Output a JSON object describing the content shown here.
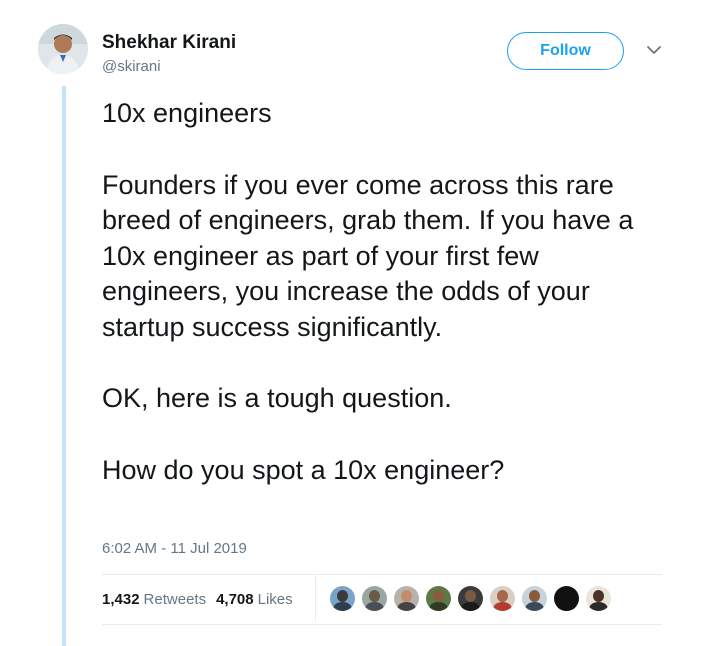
{
  "author": {
    "display_name": "Shekhar Kirani",
    "handle": "@skirani"
  },
  "follow_label": "Follow",
  "tweet": {
    "paragraphs": [
      "10x engineers",
      "Founders if you ever come across this rare breed of engineers, grab them. If you have a 10x engineer as part of your first few engineers, you increase the odds of your startup success significantly.",
      "OK, here is a tough question.",
      "How do you spot a 10x engineer?"
    ],
    "timestamp": "6:02 AM - 11 Jul 2019"
  },
  "stats": {
    "retweets_count": "1,432",
    "retweets_label": "Retweets",
    "likes_count": "4,708",
    "likes_label": "Likes"
  },
  "colors": {
    "accent": "#1da1f2",
    "thread_line": "#c4e3f6",
    "secondary_text": "#657786"
  },
  "likers": [
    {
      "name": "liker-avatar-1",
      "bg": "#7aa3c8",
      "face": "#3b3b3b",
      "torso": "#2c3e50"
    },
    {
      "name": "liker-avatar-2",
      "bg": "#9aa7a1",
      "face": "#6b5a4a",
      "torso": "#4a4f55"
    },
    {
      "name": "liker-avatar-3",
      "bg": "#b8b2ac",
      "face": "#c48c6a",
      "torso": "#444444"
    },
    {
      "name": "liker-avatar-4",
      "bg": "#5b7a45",
      "face": "#8c5a3c",
      "torso": "#2f3b24"
    },
    {
      "name": "liker-avatar-5",
      "bg": "#3a3a3a",
      "face": "#7a5a44",
      "torso": "#1b1b1b"
    },
    {
      "name": "liker-avatar-6",
      "bg": "#d9cfc4",
      "face": "#a8674a",
      "torso": "#b33a2c"
    },
    {
      "name": "liker-avatar-7",
      "bg": "#c7d3dc",
      "face": "#8a5c3e",
      "torso": "#3a4a5a"
    },
    {
      "name": "liker-avatar-8",
      "bg": "#111111",
      "face": "#111111",
      "torso": "#111111"
    },
    {
      "name": "liker-avatar-9",
      "bg": "#e9e4dc",
      "face": "#4a3326",
      "torso": "#2a2a2a"
    }
  ]
}
